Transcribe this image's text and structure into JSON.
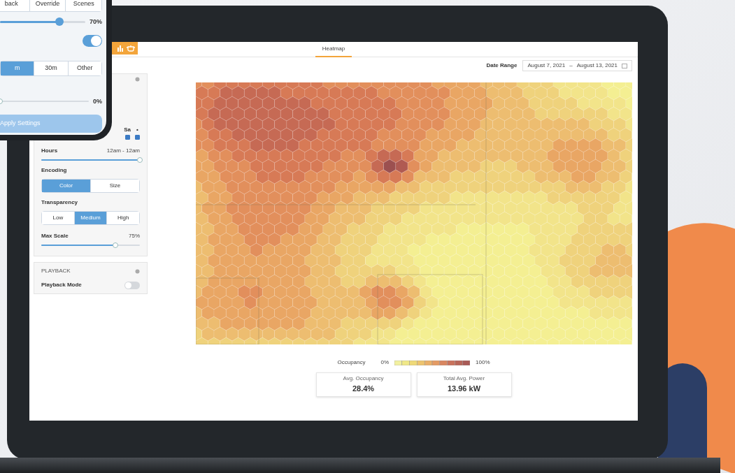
{
  "phone": {
    "modes": [
      {
        "label": "back",
        "selected": false
      },
      {
        "label": "Override",
        "selected": false
      },
      {
        "label": "Scenes",
        "selected": false
      }
    ],
    "brightness": {
      "level": 0.7,
      "reading": "70%"
    },
    "toggle": {
      "on": true
    },
    "intervals": [
      {
        "label": "m",
        "selected": true
      },
      {
        "label": "30m",
        "selected": false
      },
      {
        "label": "Other",
        "selected": false
      }
    ],
    "fade": {
      "level": 0,
      "reading": "0%"
    },
    "apply_button": "Apply Settings"
  },
  "tabs": [
    {
      "label": "Heatmap",
      "selected": true
    }
  ],
  "date_range": {
    "label": "Date Range",
    "start": "August 7, 2021",
    "separator": "–",
    "end": "August 13, 2021"
  },
  "sidebar": {
    "days": [
      {
        "label": "Sa",
        "checked": true
      },
      {
        "label": "•",
        "checked": true
      }
    ],
    "hours": {
      "label": "Hours",
      "reading": "12am - 12am",
      "level": 1
    },
    "encoding": {
      "label": "Encoding",
      "options": [
        {
          "label": "Color",
          "selected": true
        },
        {
          "label": "Size",
          "selected": false
        }
      ]
    },
    "transparency": {
      "label": "Transparency",
      "options": [
        {
          "label": "Low",
          "selected": false
        },
        {
          "label": "Medium",
          "selected": true
        },
        {
          "label": "High",
          "selected": false
        }
      ]
    },
    "max_scale": {
      "label": "Max Scale",
      "reading": "75%",
      "level": 0.75
    },
    "playback": {
      "title": "PLAYBACK",
      "mode_label": "Playback Mode",
      "on": false
    }
  },
  "legend": {
    "label": "Occupancy",
    "min": "0%",
    "max": "100%"
  },
  "stats": [
    {
      "label": "Avg. Occupancy",
      "value": "28.4%"
    },
    {
      "label": "Total Avg. Power",
      "value": "13.96 kW"
    }
  ]
}
